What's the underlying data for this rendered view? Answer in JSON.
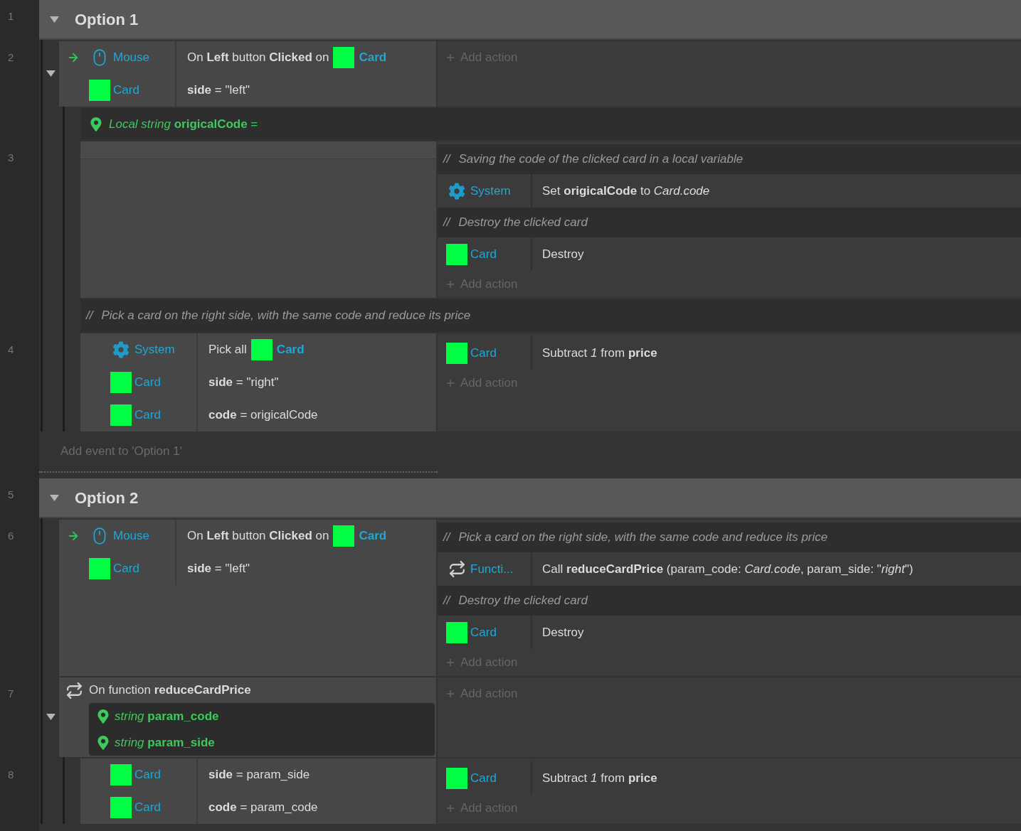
{
  "groups": [
    {
      "line": "1",
      "title": "Option 1",
      "expanded": true,
      "events": [
        {
          "kind": "event",
          "line": "2",
          "expanded": true,
          "conditions": [
            {
              "trigger": true,
              "object": {
                "kind": "mouse",
                "name": "Mouse"
              },
              "text": "On **Left** button **Clicked** on",
              "param_object": "Card"
            },
            {
              "trigger": false,
              "object": {
                "kind": "sprite",
                "name": "Card"
              },
              "text": "**side** = \"left\""
            }
          ],
          "actions": [
            {
              "kind": "add",
              "text": "Add action"
            }
          ],
          "children": [
            {
              "kind": "variable",
              "text": "*Local string* **origicalCode** ="
            },
            {
              "kind": "event",
              "line": "3",
              "actions": [
                {
                  "kind": "comment",
                  "mark": "//",
                  "text": "Saving the code of the clicked card in a local variable"
                },
                {
                  "kind": "action",
                  "object": {
                    "kind": "system",
                    "name": "System"
                  },
                  "text": "Set **origicalCode** to *Card.code*"
                },
                {
                  "kind": "comment",
                  "mark": "//",
                  "text": "Destroy the clicked card"
                },
                {
                  "kind": "action",
                  "object": {
                    "kind": "sprite",
                    "name": "Card"
                  },
                  "text": "Destroy"
                },
                {
                  "kind": "add",
                  "text": "Add action"
                }
              ]
            },
            {
              "kind": "comment",
              "mark": "//",
              "text": "Pick a card on the right side, with the same code and reduce its price"
            },
            {
              "kind": "event",
              "line": "4",
              "conditions": [
                {
                  "trigger": false,
                  "object": {
                    "kind": "system",
                    "name": "System"
                  },
                  "text": "Pick all",
                  "param_object": "Card"
                },
                {
                  "trigger": false,
                  "object": {
                    "kind": "sprite",
                    "name": "Card"
                  },
                  "text": "**side** = \"right\""
                },
                {
                  "trigger": false,
                  "object": {
                    "kind": "sprite",
                    "name": "Card"
                  },
                  "text": "**code** = origicalCode"
                }
              ],
              "actions": [
                {
                  "kind": "action",
                  "object": {
                    "kind": "sprite",
                    "name": "Card"
                  },
                  "text": "Subtract *1* from **price**"
                },
                {
                  "kind": "add",
                  "text": "Add action"
                }
              ]
            }
          ]
        }
      ],
      "add_event": "Add event to 'Option 1'"
    },
    {
      "line": "5",
      "title": "Option 2",
      "expanded": true,
      "events": [
        {
          "kind": "event",
          "line": "6",
          "conditions": [
            {
              "trigger": true,
              "object": {
                "kind": "mouse",
                "name": "Mouse"
              },
              "text": "On **Left** button **Clicked** on",
              "param_object": "Card"
            },
            {
              "trigger": false,
              "object": {
                "kind": "sprite",
                "name": "Card"
              },
              "text": "**side** = \"left\""
            }
          ],
          "actions": [
            {
              "kind": "comment",
              "mark": "//",
              "text": "Pick a card on the right side, with the same code and reduce its price"
            },
            {
              "kind": "action",
              "object": {
                "kind": "function",
                "name": "Functi..."
              },
              "text": "Call **reduceCardPrice** (param_code: *Card.code*, param_side: \"*right*\")"
            },
            {
              "kind": "comment",
              "mark": "//",
              "text": "Destroy the clicked card"
            },
            {
              "kind": "action",
              "object": {
                "kind": "sprite",
                "name": "Card"
              },
              "text": "Destroy"
            },
            {
              "kind": "add",
              "text": "Add action"
            }
          ]
        },
        {
          "kind": "function",
          "line": "7",
          "expanded": true,
          "header": "On function **reduceCardPrice**",
          "params": [
            {
              "text": "*string* **param_code**"
            },
            {
              "text": "*string* **param_side**"
            }
          ],
          "actions": [
            {
              "kind": "add",
              "text": "Add action"
            }
          ],
          "children": [
            {
              "kind": "event",
              "line": "8",
              "conditions": [
                {
                  "trigger": false,
                  "object": {
                    "kind": "sprite",
                    "name": "Card"
                  },
                  "text": "**side** = param_side"
                },
                {
                  "trigger": false,
                  "object": {
                    "kind": "sprite",
                    "name": "Card"
                  },
                  "text": "**code** = param_code"
                }
              ],
              "actions": [
                {
                  "kind": "action",
                  "object": {
                    "kind": "sprite",
                    "name": "Card"
                  },
                  "text": "Subtract *1* from **price**"
                },
                {
                  "kind": "add",
                  "text": "Add action"
                }
              ]
            }
          ]
        }
      ]
    }
  ]
}
